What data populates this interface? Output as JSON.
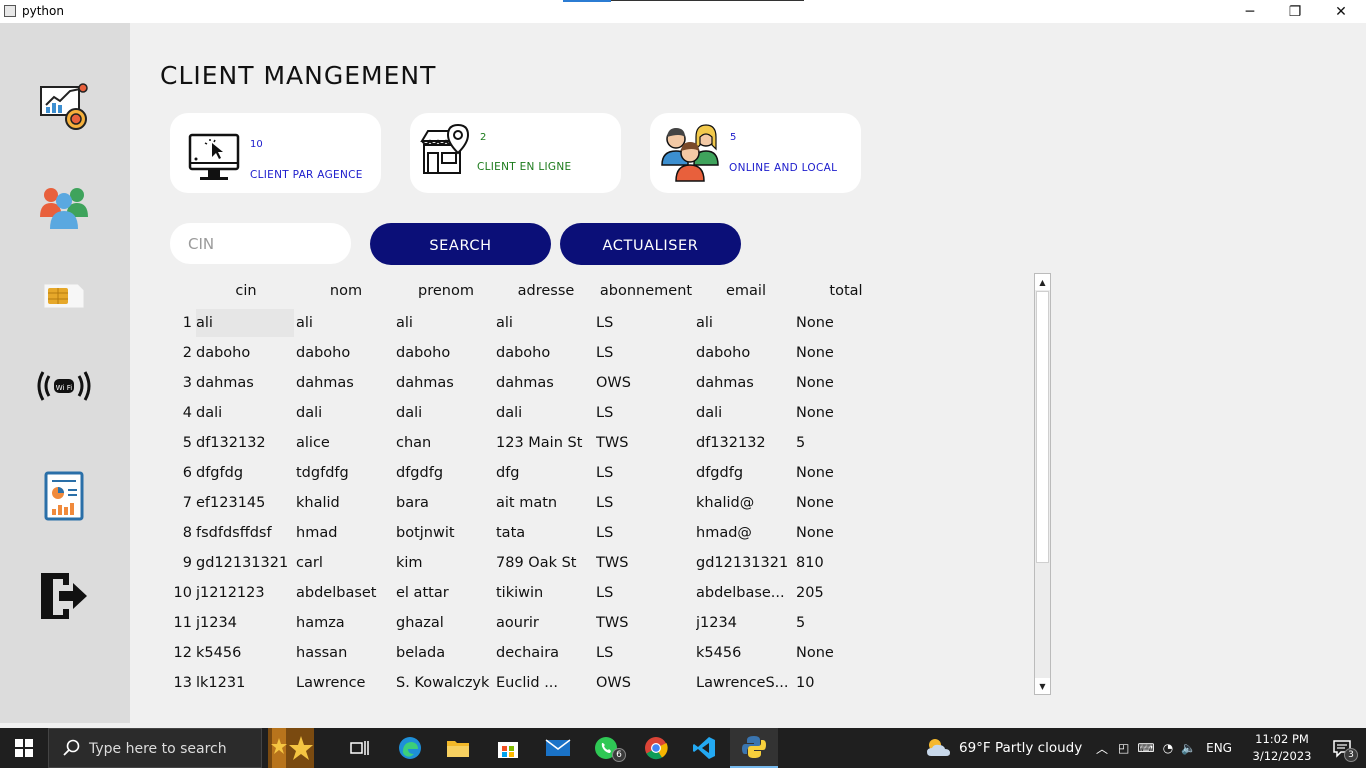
{
  "window": {
    "title": "python",
    "minimize_glyph": "─",
    "maximize_glyph": "❐",
    "close_glyph": "✕"
  },
  "sidebar": {
    "items": [
      {
        "icon": "dashboard-chart-icon"
      },
      {
        "icon": "users-group-icon"
      },
      {
        "icon": "sim-card-icon"
      },
      {
        "icon": "wifi-signal-icon"
      },
      {
        "icon": "report-icon"
      },
      {
        "icon": "logout-icon"
      }
    ]
  },
  "header": {
    "title": "CLIENT MANGEMENT"
  },
  "cards": [
    {
      "count": "10",
      "label": "CLIENT PAR AGENCE",
      "color": "#1c1ccc",
      "icon": "computer-click-icon"
    },
    {
      "count": "2",
      "label": "CLIENT EN LIGNE",
      "color": "#1a7a1a",
      "icon": "store-location-icon"
    },
    {
      "count": "5",
      "label": "ONLINE AND LOCAL",
      "color": "#1c1ccc",
      "icon": "people-icon"
    }
  ],
  "search": {
    "placeholder": "CIN",
    "search_label": "SEARCH",
    "refresh_label": "ACTUALISER"
  },
  "table": {
    "columns": [
      "cin",
      "nom",
      "prenom",
      "adresse",
      "abonnement",
      "email",
      "total"
    ],
    "rows": [
      {
        "n": "1",
        "cells": [
          "ali",
          "ali",
          "ali",
          "ali",
          "LS",
          "ali",
          "None"
        ]
      },
      {
        "n": "2",
        "cells": [
          "daboho",
          "daboho",
          "daboho",
          "daboho",
          "LS",
          "daboho",
          "None"
        ]
      },
      {
        "n": "3",
        "cells": [
          "dahmas",
          "dahmas",
          "dahmas",
          "dahmas",
          "OWS",
          "dahmas",
          "None"
        ]
      },
      {
        "n": "4",
        "cells": [
          "dali",
          "dali",
          "dali",
          "dali",
          "LS",
          "dali",
          "None"
        ]
      },
      {
        "n": "5",
        "cells": [
          "df132132",
          "alice",
          "chan",
          "123 Main St",
          "TWS",
          "df132132",
          "5"
        ]
      },
      {
        "n": "6",
        "cells": [
          "dfgfdg",
          "tdgfdfg",
          "dfgdfg",
          "dfg",
          "LS",
          "dfgdfg",
          "None"
        ]
      },
      {
        "n": "7",
        "cells": [
          "ef123145",
          "khalid",
          "bara",
          "ait matn",
          "LS",
          "khalid@",
          "None"
        ]
      },
      {
        "n": "8",
        "cells": [
          "fsdfdsffdsf",
          "hmad",
          "botjnwit",
          "tata",
          "LS",
          "hmad@",
          "None"
        ]
      },
      {
        "n": "9",
        "cells": [
          "gd12131321",
          "carl",
          "kim",
          "789 Oak St",
          "TWS",
          "gd12131321",
          "810"
        ]
      },
      {
        "n": "10",
        "cells": [
          "j1212123",
          "abdelbaset",
          "el attar",
          "tikiwin",
          "LS",
          "abdelbase...",
          "205"
        ]
      },
      {
        "n": "11",
        "cells": [
          "j1234",
          "hamza",
          "ghazal",
          "aourir",
          "TWS",
          "j1234",
          "5"
        ]
      },
      {
        "n": "12",
        "cells": [
          "k5456",
          "hassan",
          "belada",
          "dechaira",
          "LS",
          "k5456",
          "None"
        ]
      },
      {
        "n": "13",
        "cells": [
          "lk1231",
          "Lawrence",
          "S. Kowalczyk",
          "Euclid ...",
          "OWS",
          "LawrenceS...",
          "10"
        ]
      }
    ]
  },
  "taskbar": {
    "search_placeholder": "Type here to search",
    "whatsapp_badge": "6",
    "weather": "69°F  Partly cloudy",
    "lang": "ENG",
    "time": "11:02 PM",
    "date": "3/12/2023",
    "notifications": "3"
  }
}
